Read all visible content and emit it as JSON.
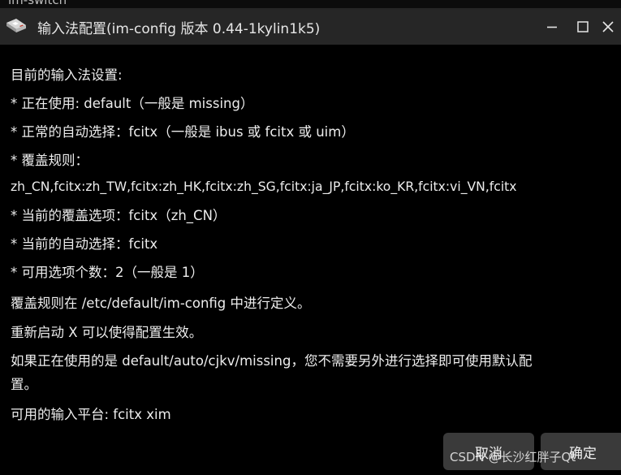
{
  "top_strip": {
    "text": "im-switch"
  },
  "window": {
    "title": "输入法配置(im-config 版本 0.44-1kylin1k5)",
    "icons": [
      "app-icon",
      "minimize-icon",
      "maximize-icon",
      "close-icon"
    ]
  },
  "content": {
    "lines": [
      "目前的输入法设置:",
      " * 正在使用: default（一般是 missing）",
      " * 正常的自动选择：fcitx（一般是 ibus 或 fcitx 或 uim）",
      " * 覆盖规则：",
      "zh_CN,fcitx:zh_TW,fcitx:zh_HK,fcitx:zh_SG,fcitx:ja_JP,fcitx:ko_KR,fcitx:vi_VN,fcitx",
      " * 当前的覆盖选项：fcitx（zh_CN）",
      " * 当前的自动选择：fcitx",
      " * 可用选项个数：2（一般是 1）",
      "覆盖规则在 /etc/default/im-config 中进行定义。",
      "重新启动 X 可以使得配置生效。",
      "如果正在使用的是 default/auto/cjkv/missing，您不需要另外进行选择即可使用默认配",
      "置。",
      " 可用的输入平台: fcitx xim"
    ]
  },
  "buttons": {
    "cancel_label": "取消",
    "ok_label": "确定"
  },
  "watermark": {
    "text": "CSDN @长沙红胖子Qt"
  },
  "colors": {
    "background": "#000000",
    "titlebar": "#262626",
    "text": "#ededed",
    "button": "#3a3a3a"
  }
}
